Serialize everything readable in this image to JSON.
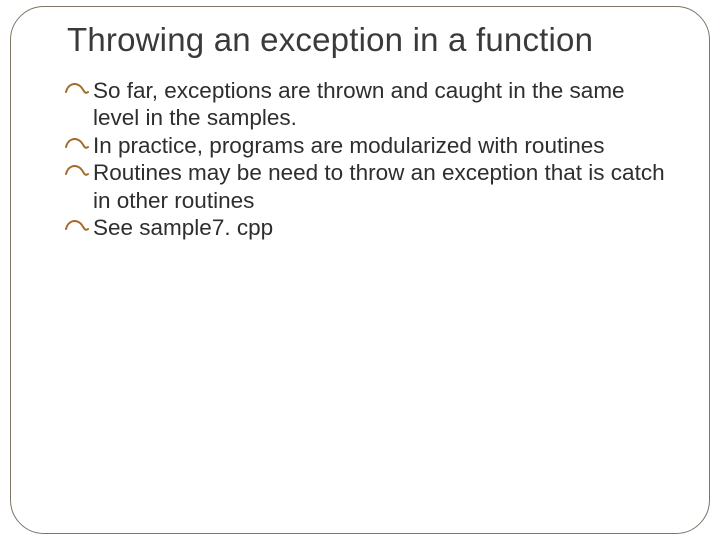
{
  "slide": {
    "title": "Throwing an exception in a function",
    "bullets": [
      "So far, exceptions are thrown and caught in the same level in the samples.",
      "In practice, programs are modularized with routines",
      "Routines may be need to throw an exception that is catch in other routines",
      "See sample7. cpp"
    ],
    "colors": {
      "bullet_icon": "#a46a2a",
      "frame_border": "#7f7564"
    }
  }
}
